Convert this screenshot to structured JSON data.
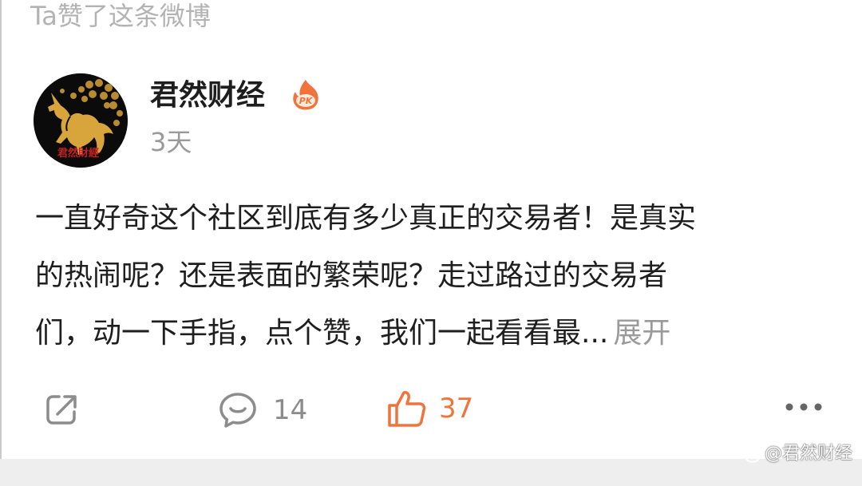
{
  "header": {
    "liked_note": "Ta赞了这条微博"
  },
  "post": {
    "author": "君然财经",
    "author_badge": "PK",
    "time": "3天",
    "text_lines": [
      "一直好奇这个社区到底有多少真正的交易者！是真实",
      "的热闹呢？还是表面的繁荣呢？走过路过的交易者",
      "们，动一下手指，点个赞，我们一起看看最..."
    ],
    "expand_label": "展开",
    "avatar_text": "君然财经"
  },
  "actions": {
    "comment_count": "14",
    "like_count": "37"
  },
  "watermark": {
    "text": "@君然财经"
  },
  "colors": {
    "accent": "#f0733c",
    "text_primary": "#1e1e1e",
    "text_secondary": "#9a9a9a",
    "icon_gray": "#8c8c8c"
  },
  "icons": {
    "share": "share-icon",
    "comment": "comment-icon",
    "like": "thumbs-up-icon",
    "more": "more-dots-icon",
    "badge": "pk-flame-icon"
  }
}
